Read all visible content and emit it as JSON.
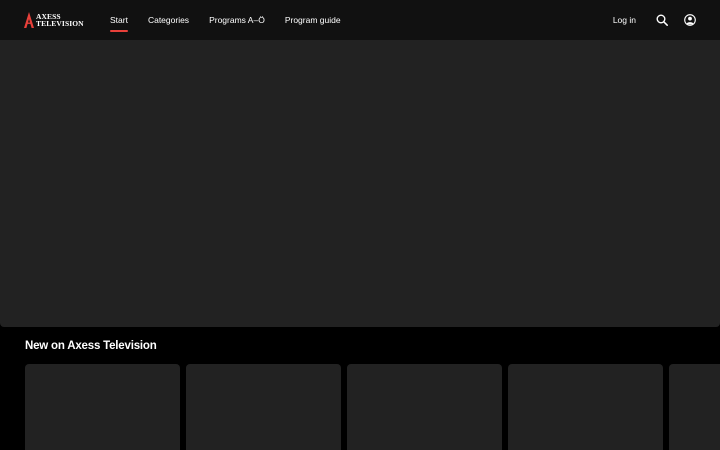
{
  "header": {
    "logo": {
      "line1": "AXESS",
      "line2": "TELEVISION",
      "accent": "#e8403a"
    },
    "nav": [
      {
        "label": "Start",
        "active": true
      },
      {
        "label": "Categories",
        "active": false
      },
      {
        "label": "Programs A–Ö",
        "active": false
      },
      {
        "label": "Program guide",
        "active": false
      }
    ],
    "login_label": "Log in",
    "icons": {
      "search": "search-icon",
      "account": "account-icon"
    }
  },
  "section": {
    "title": "New on Axess Television",
    "card_count": 5
  },
  "colors": {
    "background": "#000000",
    "header": "#111111",
    "placeholder": "#222222",
    "active_underline": "#e8403a"
  }
}
